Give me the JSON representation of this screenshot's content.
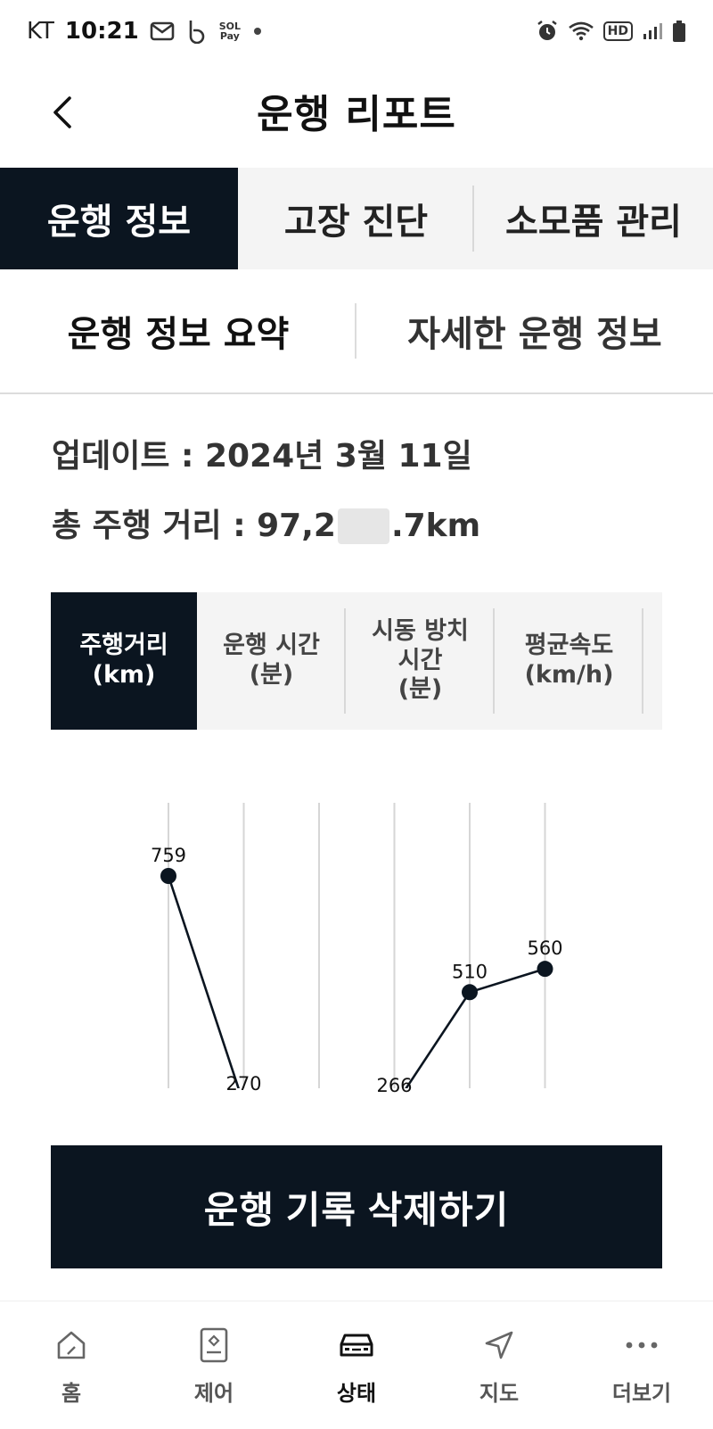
{
  "status_bar": {
    "carrier": "KT",
    "time": "10:21",
    "sol_pay_top": "SOL",
    "sol_pay_bottom": "Pay",
    "hd_label": "HD"
  },
  "header": {
    "title": "운행 리포트",
    "back_icon": "chevron-left-icon"
  },
  "main_tabs": [
    {
      "label": "운행 정보",
      "active": true
    },
    {
      "label": "고장 진단",
      "active": false
    },
    {
      "label": "소모품 관리",
      "active": false
    }
  ],
  "sub_tabs": [
    {
      "label": "운행 정보 요약",
      "active": true
    },
    {
      "label": "자세한 운행 정보",
      "active": false
    }
  ],
  "info": {
    "updated": "업데이트 : 2024년 3월 11일",
    "total_prefix": "총 주행 거리 : 97,2",
    "total_suffix": ".7km"
  },
  "metric_tabs": [
    {
      "label": "주행거리\n(km)",
      "active": true
    },
    {
      "label": "운행 시간\n(분)",
      "active": false
    },
    {
      "label": "시동 방치\n시간\n(분)",
      "active": false
    },
    {
      "label": "평균속도\n(km/h)",
      "active": false
    }
  ],
  "chart_data": {
    "type": "line",
    "title": "",
    "xlabel": "",
    "ylabel": "",
    "x": [
      1,
      2,
      3,
      4,
      5,
      6
    ],
    "segments": [
      [
        {
          "x": 1,
          "y": 759
        },
        {
          "x": 2,
          "y": 270
        }
      ],
      [
        {
          "x": 4,
          "y": 266
        },
        {
          "x": 5,
          "y": 510
        },
        {
          "x": 6,
          "y": 560
        }
      ]
    ],
    "point_labels": [
      "759",
      "270",
      "266",
      "510",
      "560"
    ],
    "ylim": [
      266,
      759
    ],
    "grid": true,
    "color": "#0b1520"
  },
  "delete_button": {
    "label": "운행 기록 삭제하기"
  },
  "bottom_nav": [
    {
      "label": "홈",
      "icon": "home-icon",
      "active": false
    },
    {
      "label": "제어",
      "icon": "control-icon",
      "active": false
    },
    {
      "label": "상태",
      "icon": "car-icon",
      "active": true
    },
    {
      "label": "지도",
      "icon": "navigation-icon",
      "active": false
    },
    {
      "label": "더보기",
      "icon": "more-icon",
      "active": false
    }
  ]
}
